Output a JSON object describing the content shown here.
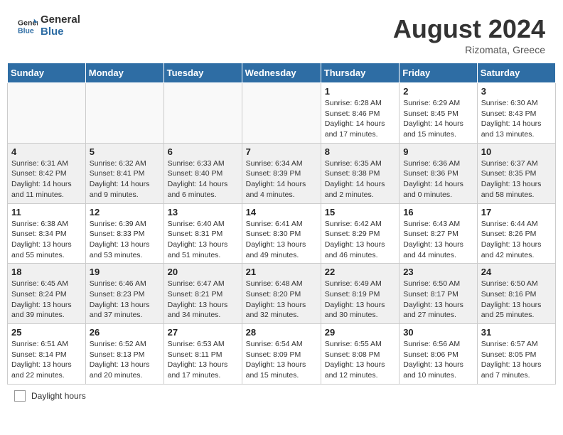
{
  "header": {
    "logo_general": "General",
    "logo_blue": "Blue",
    "month_title": "August 2024",
    "location": "Rizomata, Greece"
  },
  "days_of_week": [
    "Sunday",
    "Monday",
    "Tuesday",
    "Wednesday",
    "Thursday",
    "Friday",
    "Saturday"
  ],
  "footer": {
    "daylight_label": "Daylight hours"
  },
  "weeks": [
    [
      {
        "day": "",
        "info": ""
      },
      {
        "day": "",
        "info": ""
      },
      {
        "day": "",
        "info": ""
      },
      {
        "day": "",
        "info": ""
      },
      {
        "day": "1",
        "info": "Sunrise: 6:28 AM\nSunset: 8:46 PM\nDaylight: 14 hours and 17 minutes."
      },
      {
        "day": "2",
        "info": "Sunrise: 6:29 AM\nSunset: 8:45 PM\nDaylight: 14 hours and 15 minutes."
      },
      {
        "day": "3",
        "info": "Sunrise: 6:30 AM\nSunset: 8:43 PM\nDaylight: 14 hours and 13 minutes."
      }
    ],
    [
      {
        "day": "4",
        "info": "Sunrise: 6:31 AM\nSunset: 8:42 PM\nDaylight: 14 hours and 11 minutes."
      },
      {
        "day": "5",
        "info": "Sunrise: 6:32 AM\nSunset: 8:41 PM\nDaylight: 14 hours and 9 minutes."
      },
      {
        "day": "6",
        "info": "Sunrise: 6:33 AM\nSunset: 8:40 PM\nDaylight: 14 hours and 6 minutes."
      },
      {
        "day": "7",
        "info": "Sunrise: 6:34 AM\nSunset: 8:39 PM\nDaylight: 14 hours and 4 minutes."
      },
      {
        "day": "8",
        "info": "Sunrise: 6:35 AM\nSunset: 8:38 PM\nDaylight: 14 hours and 2 minutes."
      },
      {
        "day": "9",
        "info": "Sunrise: 6:36 AM\nSunset: 8:36 PM\nDaylight: 14 hours and 0 minutes."
      },
      {
        "day": "10",
        "info": "Sunrise: 6:37 AM\nSunset: 8:35 PM\nDaylight: 13 hours and 58 minutes."
      }
    ],
    [
      {
        "day": "11",
        "info": "Sunrise: 6:38 AM\nSunset: 8:34 PM\nDaylight: 13 hours and 55 minutes."
      },
      {
        "day": "12",
        "info": "Sunrise: 6:39 AM\nSunset: 8:33 PM\nDaylight: 13 hours and 53 minutes."
      },
      {
        "day": "13",
        "info": "Sunrise: 6:40 AM\nSunset: 8:31 PM\nDaylight: 13 hours and 51 minutes."
      },
      {
        "day": "14",
        "info": "Sunrise: 6:41 AM\nSunset: 8:30 PM\nDaylight: 13 hours and 49 minutes."
      },
      {
        "day": "15",
        "info": "Sunrise: 6:42 AM\nSunset: 8:29 PM\nDaylight: 13 hours and 46 minutes."
      },
      {
        "day": "16",
        "info": "Sunrise: 6:43 AM\nSunset: 8:27 PM\nDaylight: 13 hours and 44 minutes."
      },
      {
        "day": "17",
        "info": "Sunrise: 6:44 AM\nSunset: 8:26 PM\nDaylight: 13 hours and 42 minutes."
      }
    ],
    [
      {
        "day": "18",
        "info": "Sunrise: 6:45 AM\nSunset: 8:24 PM\nDaylight: 13 hours and 39 minutes."
      },
      {
        "day": "19",
        "info": "Sunrise: 6:46 AM\nSunset: 8:23 PM\nDaylight: 13 hours and 37 minutes."
      },
      {
        "day": "20",
        "info": "Sunrise: 6:47 AM\nSunset: 8:21 PM\nDaylight: 13 hours and 34 minutes."
      },
      {
        "day": "21",
        "info": "Sunrise: 6:48 AM\nSunset: 8:20 PM\nDaylight: 13 hours and 32 minutes."
      },
      {
        "day": "22",
        "info": "Sunrise: 6:49 AM\nSunset: 8:19 PM\nDaylight: 13 hours and 30 minutes."
      },
      {
        "day": "23",
        "info": "Sunrise: 6:50 AM\nSunset: 8:17 PM\nDaylight: 13 hours and 27 minutes."
      },
      {
        "day": "24",
        "info": "Sunrise: 6:50 AM\nSunset: 8:16 PM\nDaylight: 13 hours and 25 minutes."
      }
    ],
    [
      {
        "day": "25",
        "info": "Sunrise: 6:51 AM\nSunset: 8:14 PM\nDaylight: 13 hours and 22 minutes."
      },
      {
        "day": "26",
        "info": "Sunrise: 6:52 AM\nSunset: 8:13 PM\nDaylight: 13 hours and 20 minutes."
      },
      {
        "day": "27",
        "info": "Sunrise: 6:53 AM\nSunset: 8:11 PM\nDaylight: 13 hours and 17 minutes."
      },
      {
        "day": "28",
        "info": "Sunrise: 6:54 AM\nSunset: 8:09 PM\nDaylight: 13 hours and 15 minutes."
      },
      {
        "day": "29",
        "info": "Sunrise: 6:55 AM\nSunset: 8:08 PM\nDaylight: 13 hours and 12 minutes."
      },
      {
        "day": "30",
        "info": "Sunrise: 6:56 AM\nSunset: 8:06 PM\nDaylight: 13 hours and 10 minutes."
      },
      {
        "day": "31",
        "info": "Sunrise: 6:57 AM\nSunset: 8:05 PM\nDaylight: 13 hours and 7 minutes."
      }
    ]
  ]
}
